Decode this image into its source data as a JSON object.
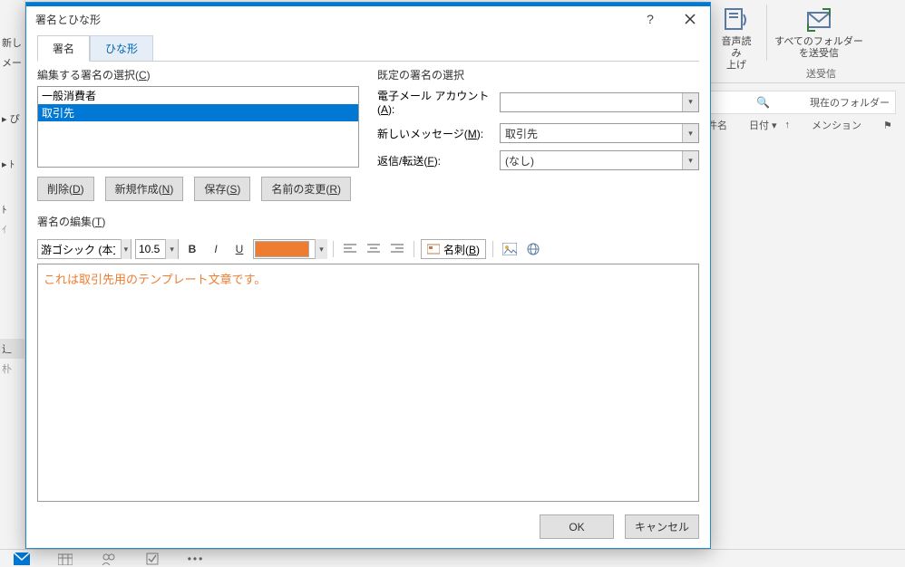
{
  "bg": {
    "ribbon_read_aloud": "音声読み\n上げ",
    "ribbon_send_folders": "すべてのフォルダー\nを送受信",
    "ribbon_section": "送受信",
    "search_placeholder": "現在のフォルダー",
    "left_new": "新し",
    "left_mail": "メー",
    "col_subject": "件名",
    "col_date": "日付",
    "col_mention": "メンション"
  },
  "dialog": {
    "title": "署名とひな形",
    "tabs": {
      "signature": "署名",
      "stationery": "ひな形"
    },
    "sigselect_label_pre": "編集する署名の選択(",
    "sigselect_label_u": "C",
    "sigselect_label_post": ")",
    "signatures": [
      "一般消費者",
      "取引先"
    ],
    "selected_index": 1,
    "buttons": {
      "delete_pre": "削除(",
      "delete_u": "D",
      "delete_post": ")",
      "new_pre": "新規作成(",
      "new_u": "N",
      "new_post": ")",
      "save_pre": "保存(",
      "save_u": "S",
      "save_post": ")",
      "rename_pre": "名前の変更(",
      "rename_u": "R",
      "rename_post": ")"
    },
    "default": {
      "heading": "既定の署名の選択",
      "account_pre": "電子メール アカウント(",
      "account_u": "A",
      "account_post": "):",
      "account_value": "",
      "newmsg_pre": "新しいメッセージ(",
      "newmsg_u": "M",
      "newmsg_post": "):",
      "newmsg_value": "取引先",
      "reply_pre": "返信/転送(",
      "reply_u": "F",
      "reply_post": "):",
      "reply_value": "(なし)"
    },
    "edit_label_pre": "署名の編集(",
    "edit_label_u": "T",
    "edit_label_post": ")",
    "toolbar": {
      "font": "游ゴシック (本文の",
      "size": "10.5",
      "color": "#ed7d31",
      "bizcard_pre": "名刺(",
      "bizcard_u": "B",
      "bizcard_post": ")"
    },
    "editor_text": "これは取引先用のテンプレート文章です。",
    "footer": {
      "ok": "OK",
      "cancel": "キャンセル"
    }
  }
}
